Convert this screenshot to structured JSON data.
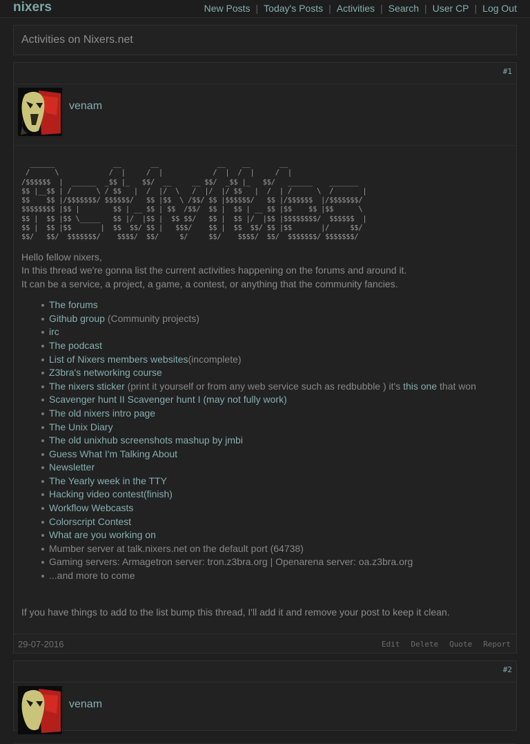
{
  "site": {
    "logo": "nixers"
  },
  "nav": {
    "items": [
      "New Posts",
      "Today's Posts",
      "Activities",
      "Search",
      "User CP",
      "Log Out"
    ],
    "separator": "|"
  },
  "thread": {
    "title": "Activities on Nixers.net"
  },
  "colors": {
    "background": "#1f1f1f",
    "panel": "#222222",
    "link": "#86aeb0",
    "text": "#8a8a8a"
  },
  "post1": {
    "number": "#1",
    "author": "venam",
    "ascii_art": "  ______              __       __              __    __       __\n /      \\            /  |     /  |            /  |  /  |     /  |\n/$$$$$$  |  ______  _$$ |_   $$/  __     __ $$/  _$$ |_   $$/   ______    _______\n$$ |__$$ | /      \\ / $$   |  /  |/  \\   /  |/  |/ $$   |  /  | /      \\  /       |\n$$    $$ |/$$$$$$$/ $$$$$$/   $$ |$$  \\ /$$/ $$ |$$$$$$/   $$ |/$$$$$$  |/$$$$$$$/\n$$$$$$$$ |$$ |        $$ | __ $$ | $$  /$$/  $$ |  $$ | __ $$ |$$    $$ |$$      \\\n$$ |  $$ |$$ \\_____   $$ |/  |$$ |  $$ $$/   $$ |  $$ |/  |$$ |$$$$$$$$/  $$$$$$  |\n$$ |  $$ |$$       |  $$  $$/ $$ |   $$$/    $$ |  $$  $$/ $$ |$$       |/     $$/\n$$/   $$/  $$$$$$$/    $$$$/  $$/     $/     $$/    $$$$/  $$/  $$$$$$$/ $$$$$$$/",
    "intro": [
      "Hello fellow nixers,",
      "In this thread we're gonna list the current activities happening on the forums and around it.",
      "It can be a service, a project, a game, a contest, or anything that the community fancies."
    ],
    "items": [
      {
        "link": "The forums"
      },
      {
        "link": "Github group",
        "text": " (Community projects)"
      },
      {
        "link": "irc"
      },
      {
        "link": "The podcast"
      },
      {
        "link": "List of Nixers members websites",
        "text": "(incomplete)"
      },
      {
        "link": "Z3bra's networking course"
      },
      {
        "link": "The nixers sticker",
        "text": " (print it yourself or from any web service such as redbubble ) it's ",
        "link2": "this one",
        "text2": " that won"
      },
      {
        "link": "Scavenger hunt II",
        "link2": " Scavenger hunt I (may not fully work)"
      },
      {
        "link": "The old nixers intro page"
      },
      {
        "link": "The Unix Diary"
      },
      {
        "link": "The old unixhub screenshots mashup by jmbi"
      },
      {
        "link": "Guess What I'm Talking About"
      },
      {
        "link": "Newsletter"
      },
      {
        "link": "The Yearly week in the TTY"
      },
      {
        "link": "Hacking video contest(finish)"
      },
      {
        "link": "Workflow Webcasts"
      },
      {
        "link": "Colorscript Contest"
      },
      {
        "link": "What are you working on"
      },
      {
        "text": "Mumber server at talk.nixers.net on the default port (64738)"
      },
      {
        "text": "Gaming servers: Armagetron server: tron.z3bra.org | Openarena server: oa.z3bra.org"
      },
      {
        "text": "...and more to come"
      }
    ],
    "outro": "If you have things to add to the list bump this thread, I'll add it and remove your post to keep it clean.",
    "date": "29-07-2016",
    "actions": [
      "Edit",
      "Delete",
      "Quote",
      "Report"
    ]
  },
  "post2": {
    "number": "#2",
    "author": "venam"
  }
}
